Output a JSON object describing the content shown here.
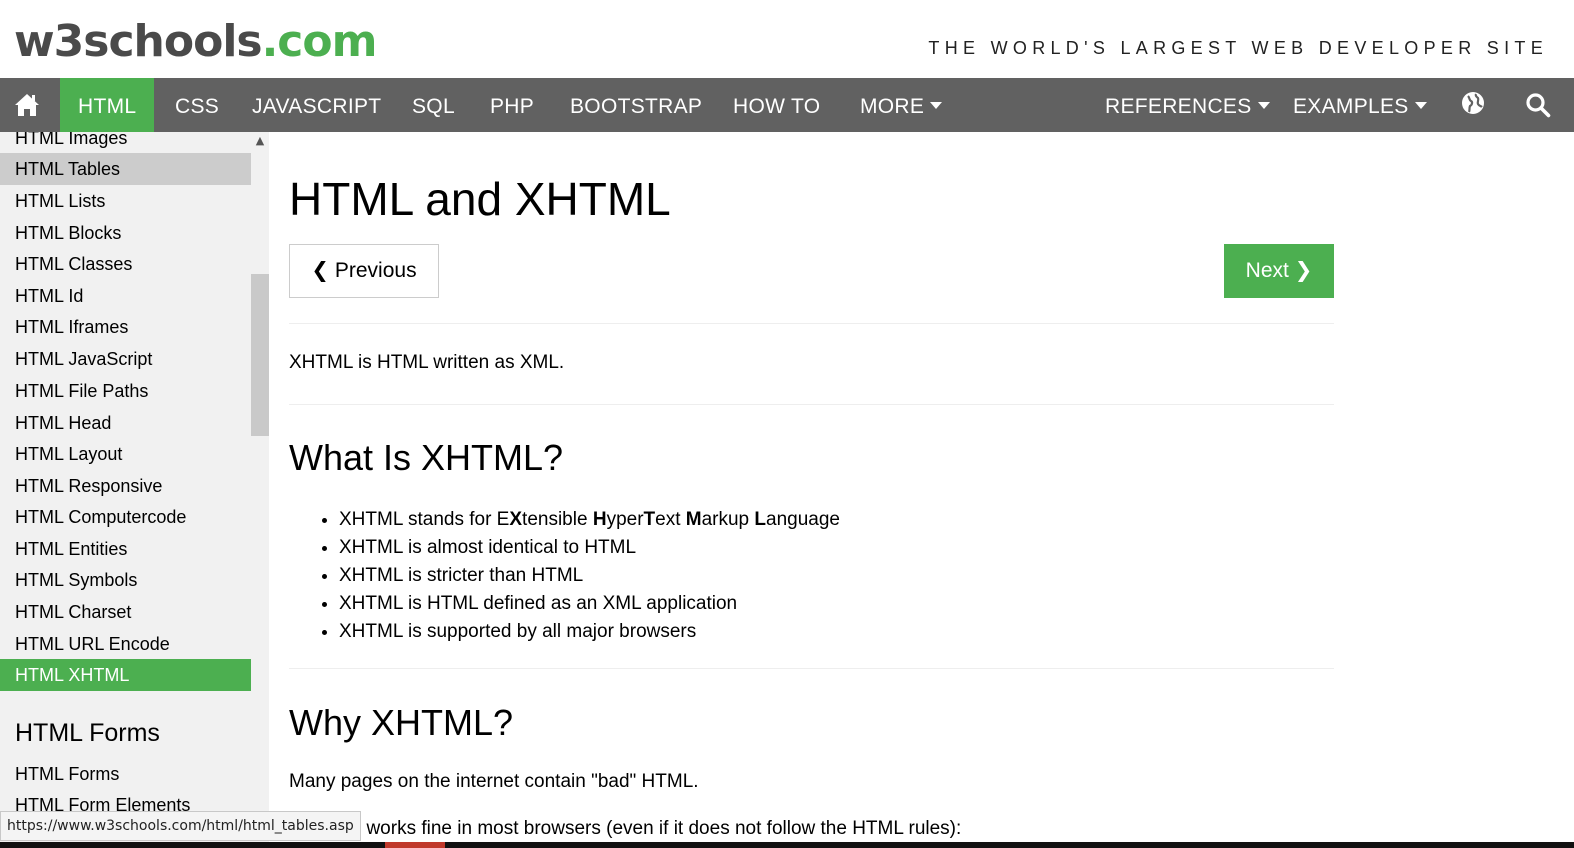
{
  "header": {
    "logo_main": "w3schools",
    "logo_suffix": ".com",
    "tagline": "THE WORLD'S LARGEST WEB DEVELOPER SITE"
  },
  "topnav": {
    "home_icon": "home-icon",
    "items": [
      "HTML",
      "CSS",
      "JAVASCRIPT",
      "SQL",
      "PHP",
      "BOOTSTRAP",
      "HOW TO",
      "MORE"
    ],
    "references": "REFERENCES",
    "examples": "EXAMPLES",
    "globe_icon": "globe-icon",
    "search_icon": "search-icon",
    "active": "HTML",
    "accent_color": "#4CAF50",
    "bar_color": "#616161"
  },
  "sidebar": {
    "links": [
      "HTML Images",
      "HTML Tables",
      "HTML Lists",
      "HTML Blocks",
      "HTML Classes",
      "HTML Id",
      "HTML Iframes",
      "HTML JavaScript",
      "HTML File Paths",
      "HTML Head",
      "HTML Layout",
      "HTML Responsive",
      "HTML Computercode",
      "HTML Entities",
      "HTML Symbols",
      "HTML Charset",
      "HTML URL Encode",
      "HTML XHTML"
    ],
    "hovered": "HTML Tables",
    "current": "HTML XHTML",
    "forms_heading": "HTML Forms",
    "forms_links": [
      "HTML Forms",
      "HTML Form Elements"
    ]
  },
  "main": {
    "title": "HTML and XHTML",
    "prev_label": "Previous",
    "next_label": "Next",
    "intro": "XHTML is HTML written as XML.",
    "what_heading": "What Is XHTML?",
    "bullets": {
      "b1": {
        "pre": "XHTML stands for E",
        "x": "X",
        "tensible": "tensible ",
        "h": "H",
        "yper": "yper",
        "t": "T",
        "ext": "ext ",
        "m": "M",
        "arkup": "arkup ",
        "l": "L",
        "anguage": "anguage"
      },
      "b2": "XHTML is almost identical to HTML",
      "b3": "XHTML is stricter than HTML",
      "b4": "XHTML is HTML defined as an XML application",
      "b5": "XHTML is supported by all major browsers"
    },
    "why_heading": "Why XHTML?",
    "why_p1": "Many pages on the internet contain \"bad\" HTML.",
    "why_p2": "ML code works fine in most browsers (even if it does not follow the HTML rules):"
  },
  "statusbar": {
    "url": "https://www.w3schools.com/html/html_tables.asp"
  }
}
